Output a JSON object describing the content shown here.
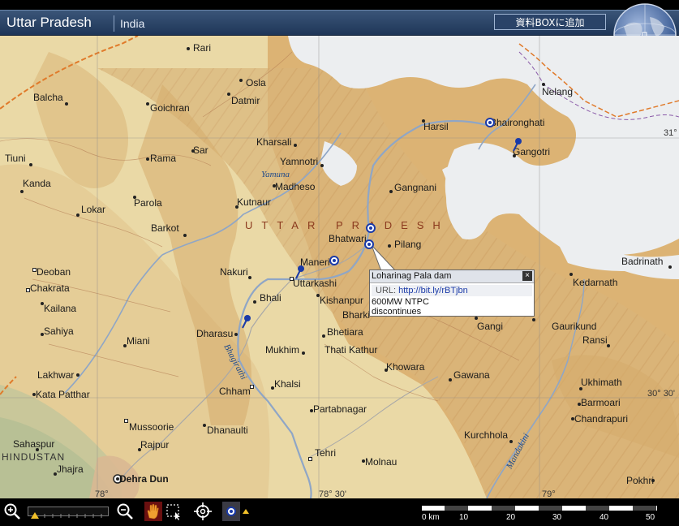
{
  "header": {
    "region_title": "Uttar Pradesh",
    "country": "India",
    "add_button": "資料BOXに追加"
  },
  "map": {
    "state_label": "UTTAR PRADESH",
    "country_label": "HINDUSTAN",
    "places": [
      {
        "name": "Rari",
        "label": "Rari"
      },
      {
        "name": "Osla",
        "label": "Osla"
      },
      {
        "name": "Balcha",
        "label": "Balcha"
      },
      {
        "name": "Goichran",
        "label": "Goichran"
      },
      {
        "name": "Datmir",
        "label": "Datmir"
      },
      {
        "name": "Nelang",
        "label": "Nelang"
      },
      {
        "name": "Harsil",
        "label": "Harsil"
      },
      {
        "name": "Bhaironghati",
        "label": "Bhaironghati"
      },
      {
        "name": "Kharsali",
        "label": "Kharsali"
      },
      {
        "name": "Gangotri",
        "label": "Gangotri"
      },
      {
        "name": "Tiuni",
        "label": "Tiuni"
      },
      {
        "name": "Sar",
        "label": "Sar"
      },
      {
        "name": "Rama",
        "label": "Rama"
      },
      {
        "name": "Yamnotri",
        "label": "Yamnotri"
      },
      {
        "name": "Kanda",
        "label": "Kanda"
      },
      {
        "name": "Madheso",
        "label": "Madheso"
      },
      {
        "name": "Gangnani",
        "label": "Gangnani"
      },
      {
        "name": "Parola",
        "label": "Parola"
      },
      {
        "name": "Kutnaur",
        "label": "Kutnaur"
      },
      {
        "name": "Lokar",
        "label": "Lokar"
      },
      {
        "name": "Barkot",
        "label": "Barkot"
      },
      {
        "name": "Bhatwari",
        "label": "Bhatwari"
      },
      {
        "name": "Pilang",
        "label": "Pilang"
      },
      {
        "name": "Badrinath",
        "label": "Badrinath"
      },
      {
        "name": "Deoban",
        "label": "Deoban"
      },
      {
        "name": "Nakuri",
        "label": "Nakuri"
      },
      {
        "name": "Maneri",
        "label": "Maneri"
      },
      {
        "name": "Uttarkashi",
        "label": "Uttarkashi"
      },
      {
        "name": "Kedarnath",
        "label": "Kedarnath"
      },
      {
        "name": "Chakrata",
        "label": "Chakrata"
      },
      {
        "name": "Bhali",
        "label": "Bhali"
      },
      {
        "name": "Kishanpur",
        "label": "Kishanpur"
      },
      {
        "name": "Kailana",
        "label": "Kailana"
      },
      {
        "name": "Bharki",
        "label": "Bharki"
      },
      {
        "name": "Gangi",
        "label": "Gangi"
      },
      {
        "name": "Gaurikund",
        "label": "Gaurikund"
      },
      {
        "name": "Sahiya",
        "label": "Sahiya"
      },
      {
        "name": "Dharasu",
        "label": "Dharasu"
      },
      {
        "name": "Bhetiara",
        "label": "Bhetiara"
      },
      {
        "name": "Miani",
        "label": "Miani"
      },
      {
        "name": "Ransi",
        "label": "Ransi"
      },
      {
        "name": "Mukhim",
        "label": "Mukhim"
      },
      {
        "name": "Thati Kathur",
        "label": "Thati Kathur"
      },
      {
        "name": "Khowara",
        "label": "Khowara"
      },
      {
        "name": "Lakhwar",
        "label": "Lakhwar"
      },
      {
        "name": "Gawana",
        "label": "Gawana"
      },
      {
        "name": "Khalsi",
        "label": "Khalsi"
      },
      {
        "name": "Ukhimath",
        "label": "Ukhimath"
      },
      {
        "name": "Chham",
        "label": "Chham"
      },
      {
        "name": "Kata Patthar",
        "label": "Kata Patthar"
      },
      {
        "name": "Barmoari",
        "label": "Barmoari"
      },
      {
        "name": "Partabnagar",
        "label": "Partabnagar"
      },
      {
        "name": "Chandrapuri",
        "label": "Chandrapuri"
      },
      {
        "name": "Mussoorie",
        "label": "Mussoorie"
      },
      {
        "name": "Dhanaulti",
        "label": "Dhanaulti"
      },
      {
        "name": "Kurchhola",
        "label": "Kurchhola"
      },
      {
        "name": "Sahaspur",
        "label": "Sahaspur"
      },
      {
        "name": "Rajpur",
        "label": "Rajpur"
      },
      {
        "name": "Tehri",
        "label": "Tehri"
      },
      {
        "name": "Jhajra",
        "label": "Jhajra"
      },
      {
        "name": "Molnau",
        "label": "Molnau"
      },
      {
        "name": "Dehra Dun",
        "label": "Dehra Dun"
      },
      {
        "name": "Pokhri",
        "label": "Pokhri"
      }
    ],
    "rivers": {
      "yamuna": "Yamuna",
      "bhagirathi": "Bhagirathi",
      "mandakini": "Mandakini"
    },
    "grid_labels": {
      "lat_31": "31°",
      "lat_30_30": "30° 30'",
      "lon_78": "78°",
      "lon_78_30": "78° 30'",
      "lon_79": "79°"
    }
  },
  "popup": {
    "title": "Loharinag Pala dam",
    "close": "×",
    "url_label": "URL: ",
    "url": "http://bit.ly/rBTjbn",
    "desc_line1": "600MW NTPC",
    "desc_line2": "discontinues"
  },
  "scalebar": {
    "labels": [
      "0 km",
      "10",
      "20",
      "30",
      "40",
      "50"
    ]
  },
  "colors": {
    "header": "#2a4368",
    "terrain_low": "#e8d6a0",
    "terrain_high": "#d2a868",
    "snow": "#eef0f2",
    "pin": "#1a3aa8"
  }
}
